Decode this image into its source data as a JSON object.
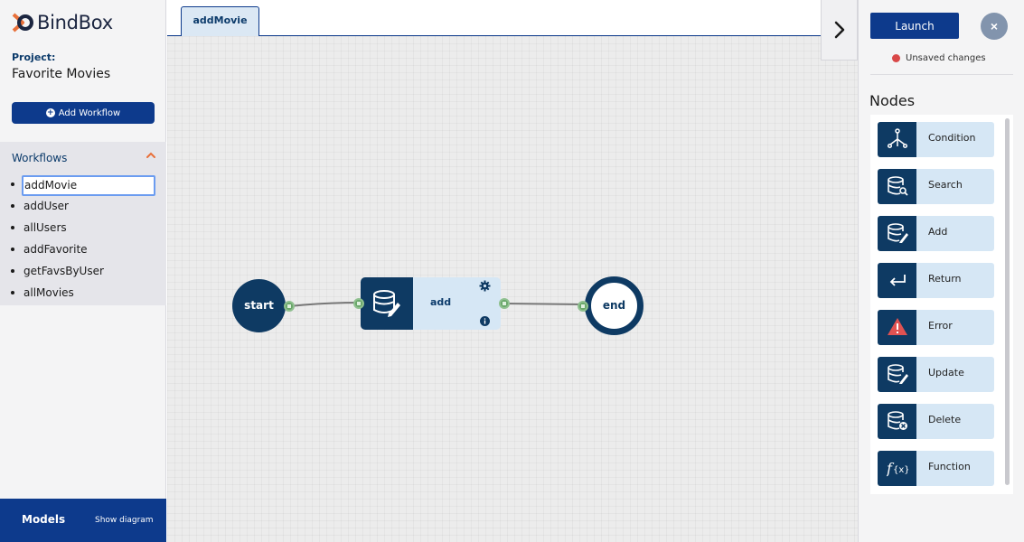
{
  "app": {
    "name": "BindBox"
  },
  "project": {
    "label": "Project:",
    "name": "Favorite Movies"
  },
  "sidebar": {
    "add_workflow_label": "Add Workflow",
    "workflows_header": "Workflows",
    "workflows": [
      "addMovie",
      "addUser",
      "allUsers",
      "addFavorite",
      "getFavsByUser",
      "allMovies"
    ],
    "active_workflow": "addMovie",
    "models_label": "Models",
    "show_diagram_label": "Show diagram"
  },
  "tabs": [
    {
      "label": "addMovie",
      "active": true
    }
  ],
  "flow": {
    "start_label": "start",
    "add_label": "add",
    "end_label": "end"
  },
  "toolbar": {
    "launch_label": "Launch",
    "close_symbol": "×",
    "status_text": "Unsaved changes",
    "status_color": "#d94848"
  },
  "nodes_panel": {
    "title": "Nodes",
    "items": [
      {
        "label": "Condition",
        "icon": "condition-icon"
      },
      {
        "label": "Search",
        "icon": "search-db-icon"
      },
      {
        "label": "Add",
        "icon": "add-db-icon"
      },
      {
        "label": "Return",
        "icon": "return-icon"
      },
      {
        "label": "Error",
        "icon": "error-icon"
      },
      {
        "label": "Update",
        "icon": "update-db-icon"
      },
      {
        "label": "Delete",
        "icon": "delete-db-icon"
      },
      {
        "label": "Function",
        "icon": "function-icon"
      }
    ]
  },
  "colors": {
    "brand": "#0d3a8c",
    "node_dark": "#0e3a63",
    "node_light": "#d6e7f5",
    "port": "#6aa76a",
    "accent_orange": "#e8703a"
  }
}
